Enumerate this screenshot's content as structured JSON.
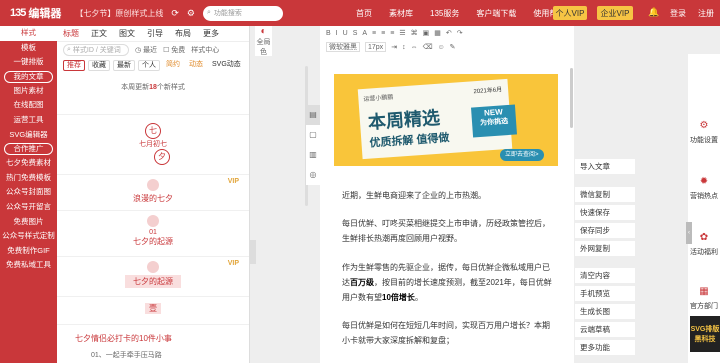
{
  "app": {
    "logo_mark": "135",
    "logo_text": "编辑器",
    "promo": "【七夕节】原创样式上线"
  },
  "search": {
    "placeholder": "功能搜索"
  },
  "nav": [
    "首页",
    "素材库",
    "135服务",
    "客户端下载",
    "使用帮助"
  ],
  "vip": {
    "personal": "个人VIP",
    "enterprise": "企业VIP"
  },
  "auth": {
    "login": "登录",
    "register": "注册"
  },
  "leftnav": [
    "样式",
    "模板",
    "一键排版",
    "我的文章",
    "图片素材",
    "在线配图",
    "运营工具",
    "SVG编辑器",
    "合作推广",
    "七夕免费素材",
    "热门免费模板",
    "公众号封面图",
    "公众号开留言",
    "免费图片",
    "公众号样式定制",
    "免费制作GIF",
    "免费私域工具"
  ],
  "panel": {
    "tabs": [
      "标题",
      "正文",
      "图文",
      "引导",
      "布局",
      "更多"
    ],
    "search_placeholder": "样式ID / 关键词",
    "recent": "最近",
    "free": "免费",
    "style_center": "样式中心",
    "filters": [
      "推荐",
      "收藏",
      "最新",
      "个人",
      "简约",
      "动态",
      "SVG动态"
    ],
    "notice_prefix": "本周更新",
    "notice_count": "18",
    "notice_suffix": "个新样式",
    "colorbar_label": "全局色",
    "cards": [
      {
        "text": "七月初七",
        "char1": "七",
        "char2": "夕"
      },
      {
        "text": "浪漫的七夕",
        "vip": "VIP"
      },
      {
        "text": "七夕的起源",
        "num": "01"
      },
      {
        "text": "七夕的起源",
        "vip": "VIP"
      },
      {
        "text": "壹"
      },
      {
        "text": "七夕情侣必打卡的10件小事",
        "sub": "01、一起手牵手压马路"
      }
    ]
  },
  "toolbar": {
    "font": "微软雅黑",
    "size": "17px"
  },
  "editor": {
    "banner": {
      "header": "运营小鹏鹏",
      "year": "2021年6月",
      "big": "本周精选",
      "sub": "优质拆解 值得做",
      "new_label": "NEW",
      "new_text": "为你挑选",
      "button": "立即去查阅>"
    },
    "paragraphs": [
      [
        "近期，生鲜电商迎来了企业的上市热潮。"
      ],
      [
        "每日优鲜、叮咚买菜相继提交上市申请，历经政策管控后，生鲜排长热潮再度回顾用户视野。"
      ],
      [
        "作为生鲜零售的先驱企业，据传，每日优鲜企微私域用户已达",
        "百万级",
        "，按目前的增长速度预测，截至2021年，每日优鲜用户数有望",
        "10倍增长",
        "。"
      ],
      [
        "每日优鲜是如何在短短几年时间，实现百万用户增长？本期小卡就带大家深度拆解和复盘；"
      ]
    ]
  },
  "rightpanel": [
    "导入文章",
    "微信复制",
    "快速保存",
    "保存同步",
    "外网复制",
    "清空内容",
    "手机预览",
    "生成长图",
    "云端草稿",
    "更多功能"
  ],
  "rightbar": [
    "功能设置",
    "营销热点",
    "活动福利",
    "官方部门"
  ],
  "ad": {
    "text": "SVG排版黑科技"
  }
}
